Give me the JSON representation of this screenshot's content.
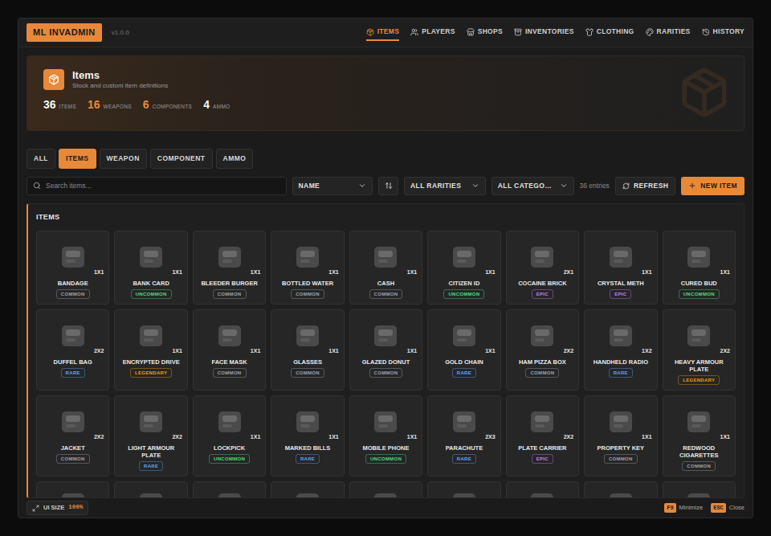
{
  "app": {
    "logo": "ML INVADMIN",
    "version": "v1.0.0"
  },
  "nav": [
    {
      "label": "ITEMS",
      "selected": true
    },
    {
      "label": "PLAYERS",
      "selected": false
    },
    {
      "label": "SHOPS",
      "selected": false
    },
    {
      "label": "INVENTORIES",
      "selected": false
    },
    {
      "label": "CLOTHING",
      "selected": false
    },
    {
      "label": "RARITIES",
      "selected": false
    },
    {
      "label": "HISTORY",
      "selected": false
    }
  ],
  "hero": {
    "title": "Items",
    "subtitle": "Stock and custom item definitions",
    "stats": [
      {
        "value": "36",
        "label": "ITEMS",
        "color": "#f2f2f2"
      },
      {
        "value": "16",
        "label": "WEAPONS",
        "color": "#e8893a"
      },
      {
        "value": "6",
        "label": "COMPONENTS",
        "color": "#e8893a"
      },
      {
        "value": "4",
        "label": "AMMO",
        "color": "#f2f2f2"
      }
    ]
  },
  "filter_tabs": [
    {
      "label": "ALL",
      "selected": false
    },
    {
      "label": "ITEMS",
      "selected": true
    },
    {
      "label": "WEAPON",
      "selected": false
    },
    {
      "label": "COMPONENT",
      "selected": false
    },
    {
      "label": "AMMO",
      "selected": false
    }
  ],
  "toolbar": {
    "search_placeholder": "Search items...",
    "sort": "NAME",
    "rarity": "ALL RARITIES",
    "category": "ALL CATEGO…",
    "count": "36 entries",
    "refresh": "REFRESH",
    "new_item": "NEW ITEM"
  },
  "section": {
    "title": "ITEMS"
  },
  "items": [
    {
      "kind": "card",
      "name": "BANDAGE",
      "size": "1X1",
      "rarity": "COMMON",
      "color": "#9ca3af"
    },
    {
      "kind": "card",
      "name": "BANK CARD",
      "size": "1X1",
      "rarity": "UNCOMMON",
      "color": "#4ade80"
    },
    {
      "kind": "card",
      "name": "BLEEDER BURGER",
      "size": "1X1",
      "rarity": "COMMON",
      "color": "#9ca3af"
    },
    {
      "kind": "card",
      "name": "BOTTLED WATER",
      "size": "1X1",
      "rarity": "COMMON",
      "color": "#9ca3af"
    },
    {
      "kind": "card",
      "name": "CASH",
      "size": "1X1",
      "rarity": "COMMON",
      "color": "#9ca3af"
    },
    {
      "kind": "card",
      "name": "CITIZEN ID",
      "size": "1X1",
      "rarity": "UNCOMMON",
      "color": "#4ade80"
    },
    {
      "kind": "card",
      "name": "COCAINE BRICK",
      "size": "2X1",
      "rarity": "EPIC",
      "color": "#c084fc"
    },
    {
      "kind": "card",
      "name": "CRYSTAL METH",
      "size": "1X1",
      "rarity": "EPIC",
      "color": "#c084fc"
    },
    {
      "kind": "card",
      "name": "CURED BUD",
      "size": "1X1",
      "rarity": "UNCOMMON",
      "color": "#4ade80"
    },
    {
      "kind": "card",
      "name": "DUFFEL BAG",
      "size": "2X2",
      "rarity": "RARE",
      "color": "#60a5fa"
    },
    {
      "kind": "card",
      "name": "ENCRYPTED DRIVE",
      "size": "1X1",
      "rarity": "LEGENDARY",
      "color": "#f59e0b"
    },
    {
      "kind": "card",
      "name": "FACE MASK",
      "size": "1X1",
      "rarity": "COMMON",
      "color": "#9ca3af"
    },
    {
      "kind": "card",
      "name": "GLASSES",
      "size": "1X1",
      "rarity": "COMMON",
      "color": "#9ca3af"
    },
    {
      "kind": "card",
      "name": "GLAZED DONUT",
      "size": "1X1",
      "rarity": "COMMON",
      "color": "#9ca3af"
    },
    {
      "kind": "card",
      "name": "GOLD CHAIN",
      "size": "1X1",
      "rarity": "RARE",
      "color": "#60a5fa"
    },
    {
      "kind": "card",
      "name": "HAM PIZZA BOX",
      "size": "2X2",
      "rarity": "COMMON",
      "color": "#9ca3af"
    },
    {
      "kind": "card",
      "name": "HANDHELD RADIO",
      "size": "1X2",
      "rarity": "RARE",
      "color": "#60a5fa"
    },
    {
      "kind": "card",
      "name": "HEAVY ARMOUR PLATE",
      "size": "2X2",
      "rarity": "LEGENDARY",
      "color": "#f59e0b"
    },
    {
      "kind": "card",
      "name": "JACKET",
      "size": "2X2",
      "rarity": "COMMON",
      "color": "#9ca3af"
    },
    {
      "kind": "card",
      "name": "LIGHT ARMOUR PLATE",
      "size": "2X2",
      "rarity": "RARE",
      "color": "#60a5fa"
    },
    {
      "kind": "card",
      "name": "LOCKPICK",
      "size": "1X1",
      "rarity": "UNCOMMON",
      "color": "#4ade80"
    },
    {
      "kind": "card",
      "name": "MARKED BILLS",
      "size": "1X1",
      "rarity": "RARE",
      "color": "#60a5fa"
    },
    {
      "kind": "card",
      "name": "MOBILE PHONE",
      "size": "1X1",
      "rarity": "UNCOMMON",
      "color": "#4ade80"
    },
    {
      "kind": "card",
      "name": "PARACHUTE",
      "size": "2X3",
      "rarity": "RARE",
      "color": "#60a5fa"
    },
    {
      "kind": "card",
      "name": "PLATE CARRIER",
      "size": "2X2",
      "rarity": "EPIC",
      "color": "#c084fc"
    },
    {
      "kind": "card",
      "name": "PROPERTY KEY",
      "size": "1X1",
      "rarity": "COMMON",
      "color": "#9ca3af"
    },
    {
      "kind": "card",
      "name": "REDWOOD CIGARETTES",
      "size": "1X1",
      "rarity": "COMMON",
      "color": "#9ca3af"
    },
    {
      "kind": "cut-off"
    },
    {
      "kind": "cut-off"
    },
    {
      "kind": "cut-off"
    },
    {
      "kind": "cut-off"
    },
    {
      "kind": "cut-off"
    },
    {
      "kind": "cut-off"
    },
    {
      "kind": "cut-off"
    },
    {
      "kind": "cut-off"
    },
    {
      "kind": "cut-off"
    }
  ],
  "footer": {
    "ui_size_label": "UI SIZE",
    "ui_size_value": "100%",
    "shortcuts": [
      {
        "key": "F9",
        "label": "Minimize"
      },
      {
        "key": "ESC",
        "label": "Close"
      }
    ]
  }
}
